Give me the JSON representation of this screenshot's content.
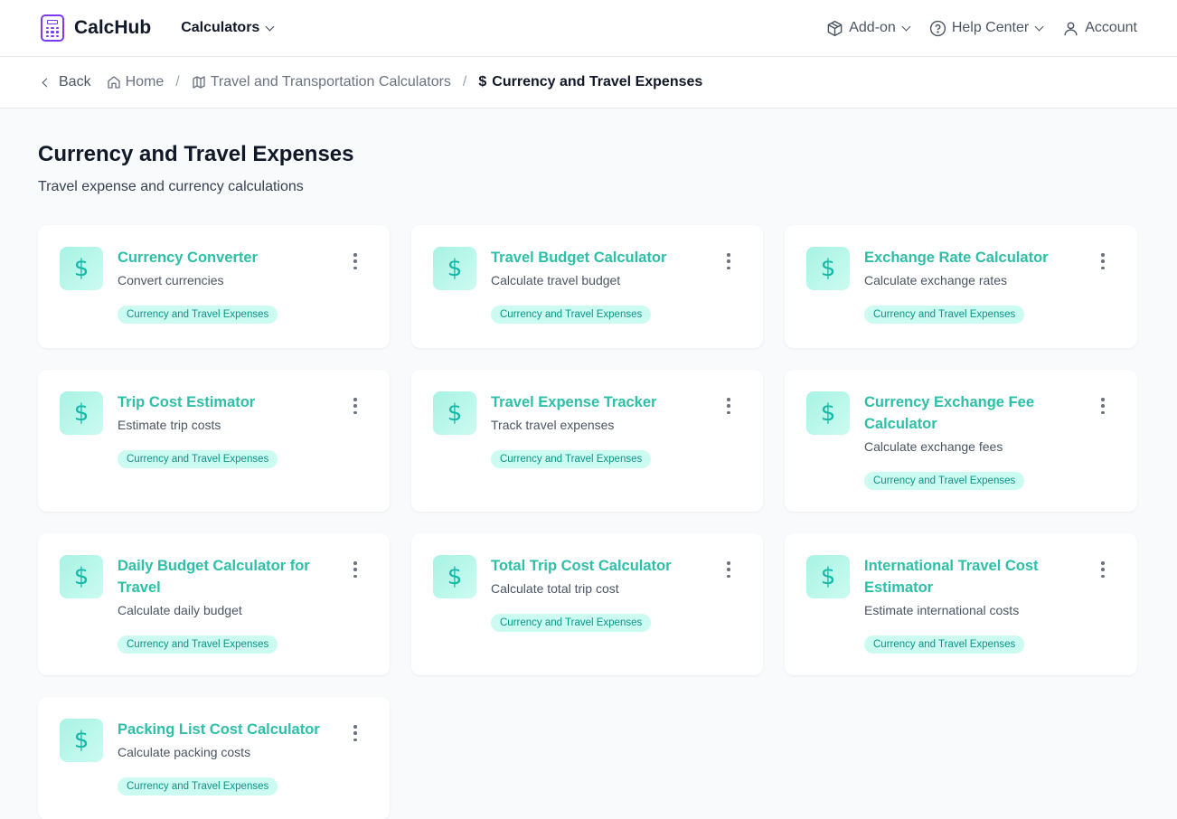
{
  "brand": {
    "name": "CalcHub",
    "accent": "#7c3aed"
  },
  "nav": {
    "calculators": "Calculators",
    "addon": "Add-on",
    "help": "Help Center",
    "account": "Account"
  },
  "breadcrumb": {
    "back": "Back",
    "home": "Home",
    "category": "Travel and Transportation Calculators",
    "current_icon": "$",
    "current": "Currency and Travel Expenses"
  },
  "page": {
    "title": "Currency and Travel Expenses",
    "subtitle": "Travel expense and currency calculations"
  },
  "theme": {
    "card_title_color": "#2dbfa7",
    "tag_bg": "#ccfbf1",
    "tag_text": "#0d9488"
  },
  "cards": [
    {
      "title": "Currency Converter",
      "description": "Convert currencies",
      "tag": "Currency and Travel Expenses",
      "icon": "dollar-icon",
      "glyph": "$"
    },
    {
      "title": "Travel Budget Calculator",
      "description": "Calculate travel budget",
      "tag": "Currency and Travel Expenses",
      "icon": "dollar-icon",
      "glyph": "$"
    },
    {
      "title": "Exchange Rate Calculator",
      "description": "Calculate exchange rates",
      "tag": "Currency and Travel Expenses",
      "icon": "dollar-icon",
      "glyph": "$"
    },
    {
      "title": "Trip Cost Estimator",
      "description": "Estimate trip costs",
      "tag": "Currency and Travel Expenses",
      "icon": "dollar-icon",
      "glyph": "$"
    },
    {
      "title": "Travel Expense Tracker",
      "description": "Track travel expenses",
      "tag": "Currency and Travel Expenses",
      "icon": "dollar-icon",
      "glyph": "$"
    },
    {
      "title": "Currency Exchange Fee Calculator",
      "description": "Calculate exchange fees",
      "tag": "Currency and Travel Expenses",
      "icon": "dollar-icon",
      "glyph": "$"
    },
    {
      "title": "Daily Budget Calculator for Travel",
      "description": "Calculate daily budget",
      "tag": "Currency and Travel Expenses",
      "icon": "dollar-icon",
      "glyph": "$"
    },
    {
      "title": "Total Trip Cost Calculator",
      "description": "Calculate total trip cost",
      "tag": "Currency and Travel Expenses",
      "icon": "dollar-icon",
      "glyph": "$"
    },
    {
      "title": "International Travel Cost Estimator",
      "description": "Estimate international costs",
      "tag": "Currency and Travel Expenses",
      "icon": "dollar-icon",
      "glyph": "$"
    },
    {
      "title": "Packing List Cost Calculator",
      "description": "Calculate packing costs",
      "tag": "Currency and Travel Expenses",
      "icon": "dollar-icon",
      "glyph": "$"
    }
  ]
}
